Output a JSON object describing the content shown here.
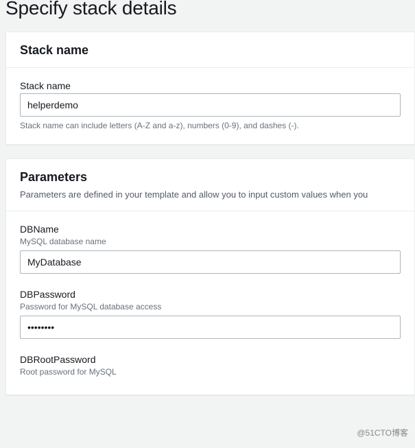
{
  "page": {
    "title": "Specify stack details"
  },
  "stack_section": {
    "header": "Stack name",
    "field_label": "Stack name",
    "value": "helperdemo",
    "hint": "Stack name can include letters (A-Z and a-z), numbers (0-9), and dashes (-)."
  },
  "parameters_section": {
    "header": "Parameters",
    "description": "Parameters are defined in your template and allow you to input custom values when you",
    "fields": {
      "dbname": {
        "label": "DBName",
        "desc": "MySQL database name",
        "value": "MyDatabase"
      },
      "dbpassword": {
        "label": "DBPassword",
        "desc": "Password for MySQL database access",
        "value": "••••••••"
      },
      "dbrootpassword": {
        "label": "DBRootPassword",
        "desc": "Root password for MySQL"
      }
    }
  },
  "watermark": "@51CTO博客"
}
